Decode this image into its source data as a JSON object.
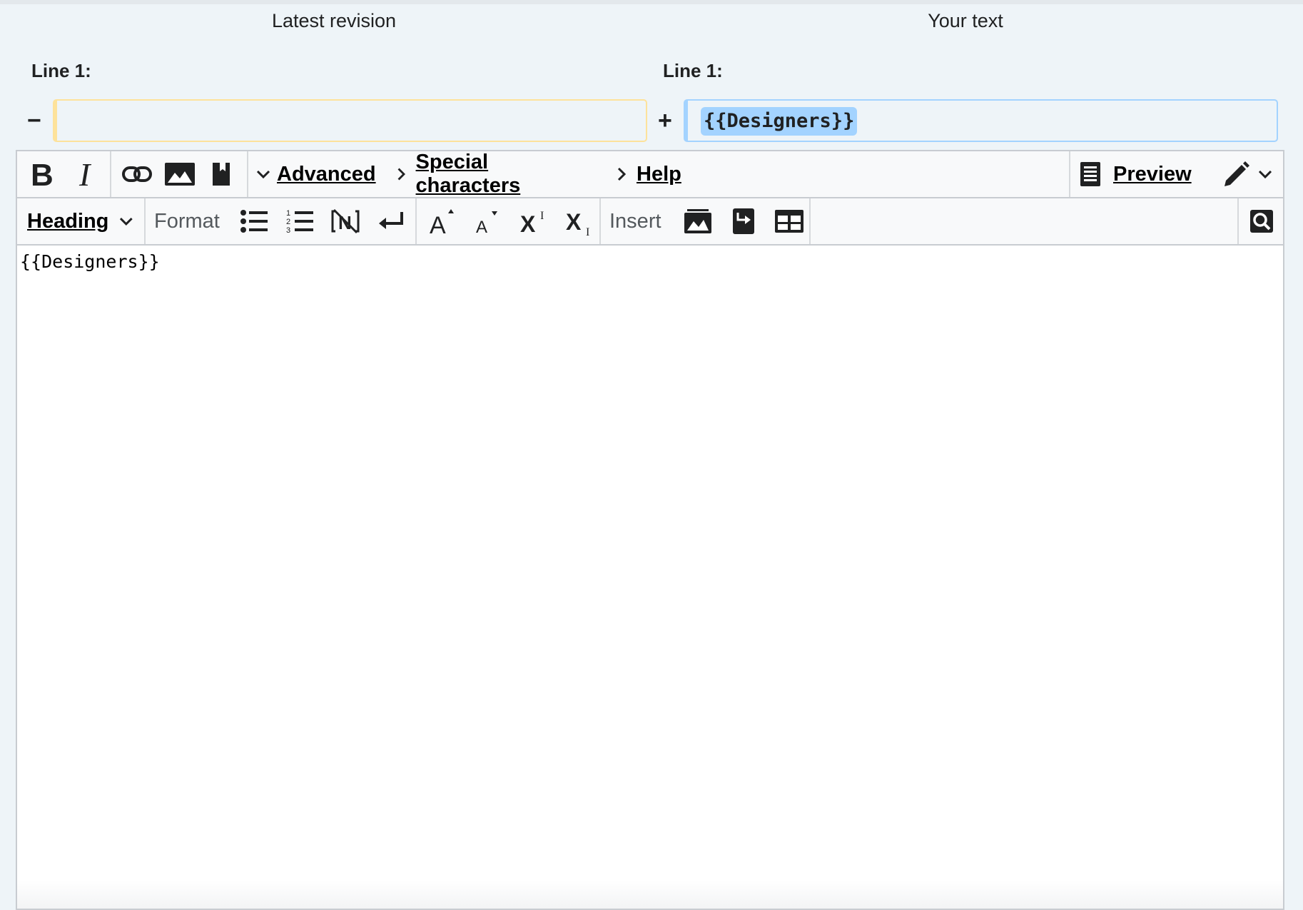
{
  "diff": {
    "left_title": "Latest revision",
    "right_title": "Your text",
    "left_line_label": "Line 1:",
    "right_line_label": "Line 1:",
    "minus_marker": "−",
    "plus_marker": "+",
    "deleted_text": "",
    "added_text": "{{Designers}}"
  },
  "toolbar": {
    "primary": {
      "bold_icon": "bold-icon",
      "italic_icon": "italic-icon",
      "link_icon": "link-icon",
      "image_icon": "image-icon",
      "reference_icon": "bookmark-icon",
      "advanced_label": "Advanced",
      "special_characters_label": "Special characters",
      "help_label": "Help",
      "preview_label": "Preview",
      "edit_mode_icon": "pencil-icon"
    },
    "secondary": {
      "heading_label": "Heading",
      "format_label": "Format",
      "bulleted_list_icon": "bulleted-list-icon",
      "numbered_list_icon": "numbered-list-icon",
      "nowiki_icon": "nowiki-icon",
      "newline_icon": "newline-icon",
      "big_icon": "big-text-icon",
      "small_icon": "small-text-icon",
      "superscript_icon": "superscript-icon",
      "subscript_icon": "subscript-icon",
      "insert_label": "Insert",
      "gallery_icon": "gallery-icon",
      "redirect_icon": "redirect-icon",
      "table_icon": "table-icon",
      "search_replace_icon": "search-replace-icon"
    }
  },
  "editor": {
    "content": "{{Designers}}"
  }
}
